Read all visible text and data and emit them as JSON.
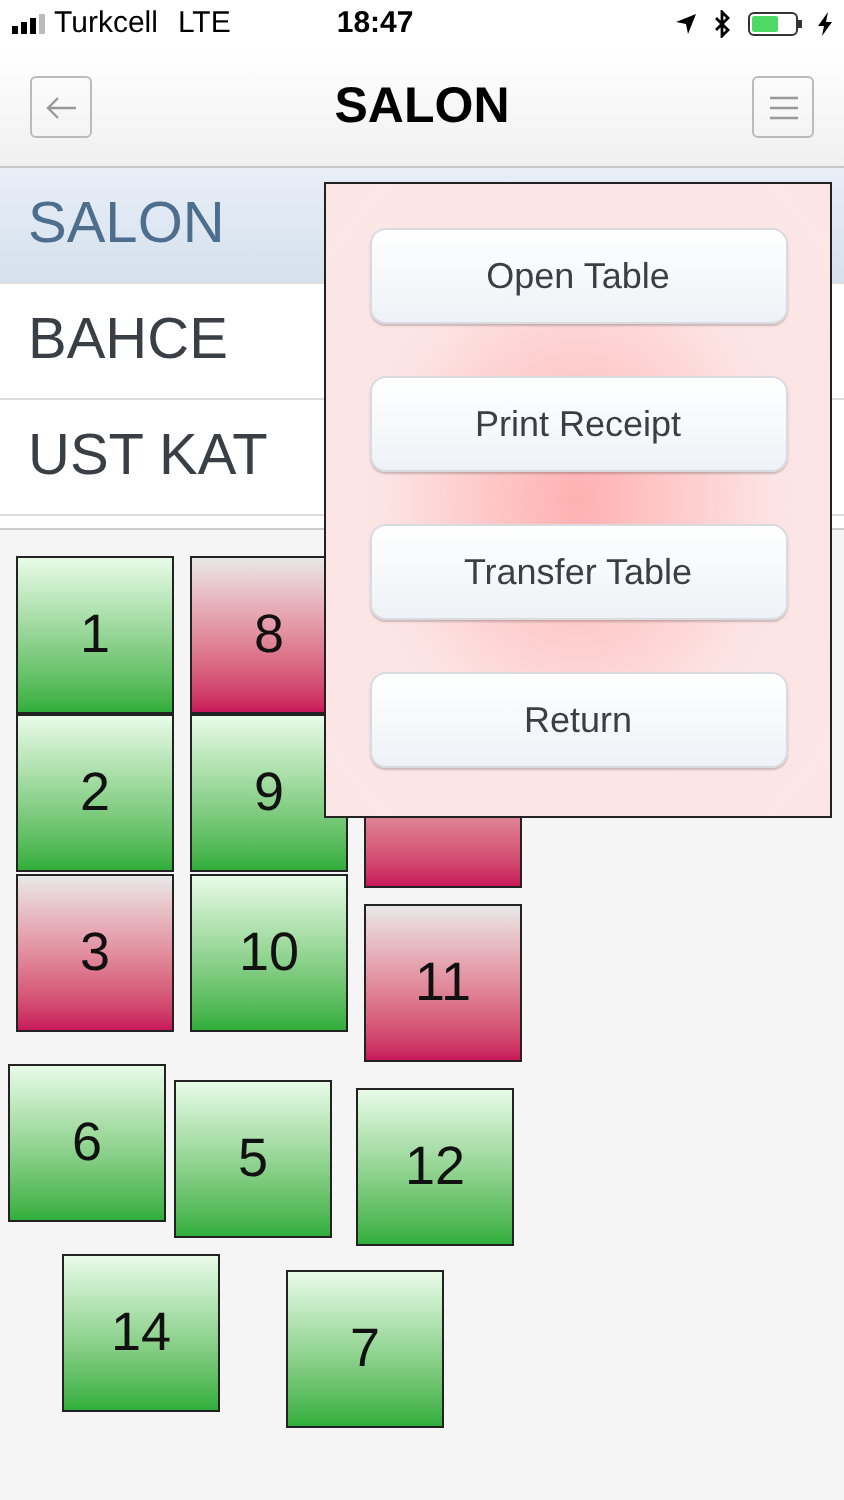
{
  "status_bar": {
    "carrier": "Turkcell",
    "network": "LTE",
    "time": "18:47",
    "battery": {
      "level": 0.6
    }
  },
  "nav": {
    "title": "SALON"
  },
  "areas": [
    {
      "label": "SALON",
      "selected": true
    },
    {
      "label": "BAHCE",
      "selected": false
    },
    {
      "label": "UST KAT",
      "selected": false
    }
  ],
  "tables": [
    {
      "number": "1",
      "occupied": false
    },
    {
      "number": "8",
      "occupied": true
    },
    {
      "number": "2",
      "occupied": false
    },
    {
      "number": "9",
      "occupied": false
    },
    {
      "occupied": true
    },
    {
      "number": "3",
      "occupied": true
    },
    {
      "number": "10",
      "occupied": false
    },
    {
      "number": "11",
      "occupied": true
    },
    {
      "number": "6",
      "occupied": false
    },
    {
      "number": "5",
      "occupied": false
    },
    {
      "number": "12",
      "occupied": false
    },
    {
      "number": "14",
      "occupied": false
    },
    {
      "number": "7",
      "occupied": false
    }
  ],
  "popup": {
    "buttons": [
      "Open Table",
      "Print Receipt",
      "Transfer Table",
      "Return"
    ]
  }
}
